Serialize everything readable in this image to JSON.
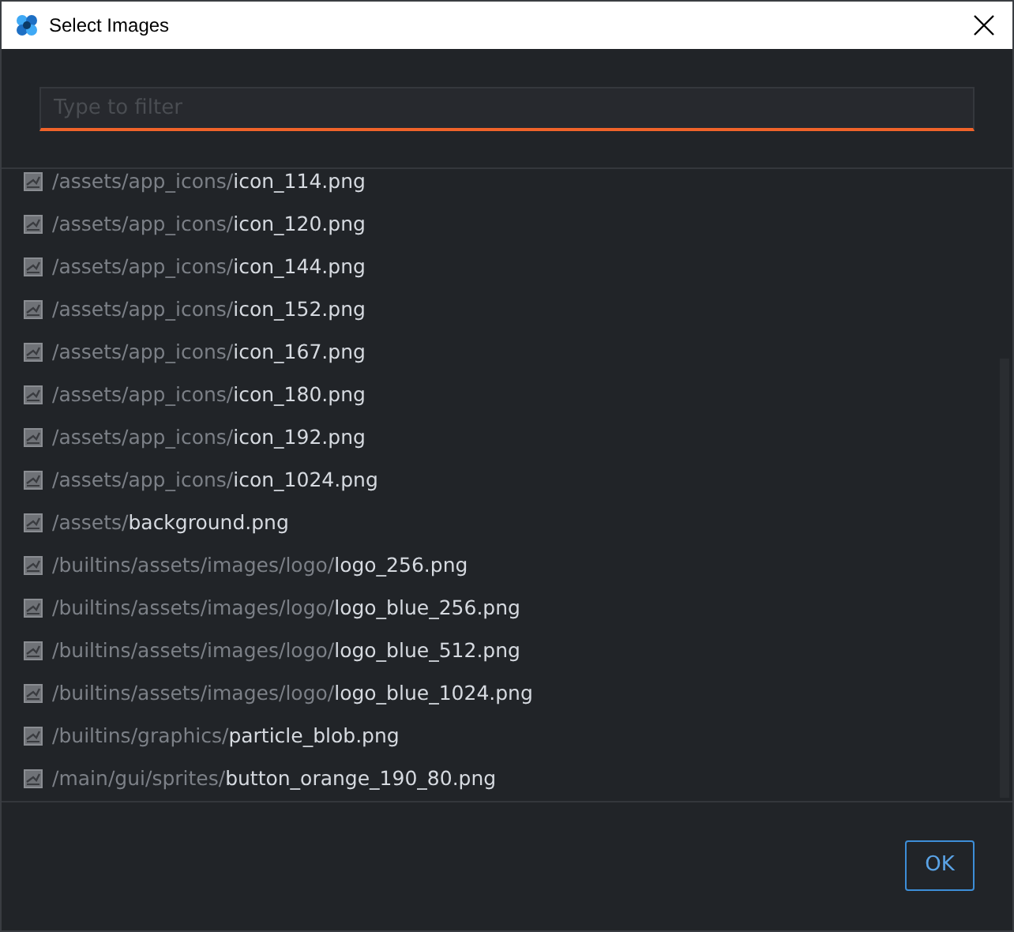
{
  "window": {
    "title": "Select Images"
  },
  "filter": {
    "placeholder": "Type to filter"
  },
  "files": [
    {
      "dir": "/assets/app_icons/",
      "name": "icon_114.png"
    },
    {
      "dir": "/assets/app_icons/",
      "name": "icon_120.png"
    },
    {
      "dir": "/assets/app_icons/",
      "name": "icon_144.png"
    },
    {
      "dir": "/assets/app_icons/",
      "name": "icon_152.png"
    },
    {
      "dir": "/assets/app_icons/",
      "name": "icon_167.png"
    },
    {
      "dir": "/assets/app_icons/",
      "name": "icon_180.png"
    },
    {
      "dir": "/assets/app_icons/",
      "name": "icon_192.png"
    },
    {
      "dir": "/assets/app_icons/",
      "name": "icon_1024.png"
    },
    {
      "dir": "/assets/",
      "name": "background.png"
    },
    {
      "dir": "/builtins/assets/images/logo/",
      "name": "logo_256.png"
    },
    {
      "dir": "/builtins/assets/images/logo/",
      "name": "logo_blue_256.png"
    },
    {
      "dir": "/builtins/assets/images/logo/",
      "name": "logo_blue_512.png"
    },
    {
      "dir": "/builtins/assets/images/logo/",
      "name": "logo_blue_1024.png"
    },
    {
      "dir": "/builtins/graphics/",
      "name": "particle_blob.png"
    },
    {
      "dir": "/main/gui/sprites/",
      "name": "button_orange_190_80.png"
    }
  ],
  "buttons": [
    "OK"
  ]
}
